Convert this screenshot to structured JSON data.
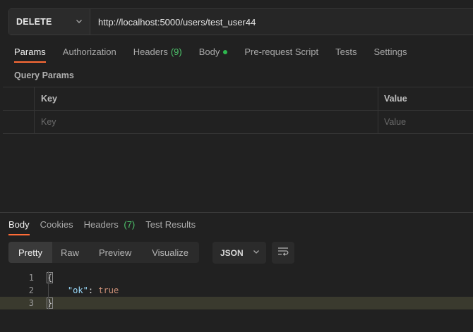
{
  "request": {
    "method": "DELETE",
    "url": "http://localhost:5000/users/test_user44"
  },
  "request_tabs": {
    "params": "Params",
    "authorization": "Authorization",
    "headers": "Headers",
    "headers_count": "(9)",
    "body": "Body",
    "prerequest": "Pre-request Script",
    "tests": "Tests",
    "settings": "Settings"
  },
  "query_params": {
    "title": "Query Params",
    "col_key": "Key",
    "col_value": "Value",
    "key_placeholder": "Key",
    "value_placeholder": "Value"
  },
  "response_tabs": {
    "body": "Body",
    "cookies": "Cookies",
    "headers": "Headers",
    "headers_count": "(7)",
    "test_results": "Test Results"
  },
  "view_modes": {
    "pretty": "Pretty",
    "raw": "Raw",
    "preview": "Preview",
    "visualize": "Visualize"
  },
  "format": "JSON",
  "code": {
    "line_numbers": [
      "1",
      "2",
      "3"
    ],
    "open_brace": "{",
    "key": "\"ok\"",
    "colon": ": ",
    "value": "true",
    "close_brace": "}"
  },
  "colors": {
    "accent": "#ff6c37",
    "green": "#4ec46b",
    "background": "#212121"
  },
  "icons": {
    "method_dropdown": "chevron-down-icon",
    "format_dropdown": "chevron-down-icon",
    "wrap": "text-wrap-icon"
  }
}
